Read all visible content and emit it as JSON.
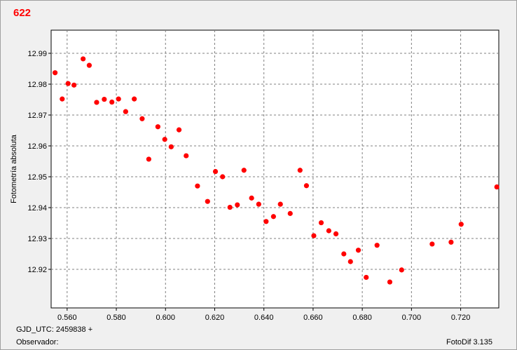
{
  "chart_data": {
    "type": "scatter",
    "title": "622",
    "xlabel": "",
    "ylabel": "Fotometría absoluta",
    "xlim": [
      0.5535,
      0.7355
    ],
    "ylim": [
      12.9975,
      12.9075
    ],
    "y_inverted": true,
    "grid": true,
    "marker_color": "#ff0000",
    "x_ticks": [
      "0.560",
      "0.580",
      "0.600",
      "0.620",
      "0.640",
      "0.660",
      "0.680",
      "0.700",
      "0.720"
    ],
    "x_tick_values": [
      0.56,
      0.58,
      0.6,
      0.62,
      0.64,
      0.66,
      0.68,
      0.7,
      0.72
    ],
    "y_ticks": [
      "12.92",
      "12.93",
      "12.94",
      "12.95",
      "12.96",
      "12.97",
      "12.98",
      "12.99"
    ],
    "y_tick_values": [
      12.92,
      12.93,
      12.94,
      12.95,
      12.96,
      12.97,
      12.98,
      12.99
    ],
    "points": [
      [
        0.5551,
        12.9837
      ],
      [
        0.558,
        12.9752
      ],
      [
        0.5604,
        12.9802
      ],
      [
        0.5628,
        12.9797
      ],
      [
        0.5665,
        12.9882
      ],
      [
        0.569,
        12.9861
      ],
      [
        0.572,
        12.9741
      ],
      [
        0.5751,
        12.9751
      ],
      [
        0.5782,
        12.9742
      ],
      [
        0.5809,
        12.9752
      ],
      [
        0.5838,
        12.9711
      ],
      [
        0.5873,
        12.9752
      ],
      [
        0.5905,
        12.9688
      ],
      [
        0.5932,
        12.9557
      ],
      [
        0.5969,
        12.9662
      ],
      [
        0.5997,
        12.9621
      ],
      [
        0.6023,
        12.9597
      ],
      [
        0.6055,
        12.9652
      ],
      [
        0.6084,
        12.9568
      ],
      [
        0.613,
        12.947
      ],
      [
        0.6171,
        12.942
      ],
      [
        0.6203,
        12.9517
      ],
      [
        0.6232,
        12.95
      ],
      [
        0.6262,
        12.9401
      ],
      [
        0.6292,
        12.9409
      ],
      [
        0.6319,
        12.9521
      ],
      [
        0.635,
        12.9431
      ],
      [
        0.6379,
        12.9411
      ],
      [
        0.6409,
        12.9355
      ],
      [
        0.6439,
        12.9371
      ],
      [
        0.6467,
        12.9411
      ],
      [
        0.6507,
        12.9381
      ],
      [
        0.6547,
        12.9521
      ],
      [
        0.6573,
        12.9471
      ],
      [
        0.6603,
        12.9309
      ],
      [
        0.6633,
        12.9351
      ],
      [
        0.6664,
        12.9325
      ],
      [
        0.6693,
        12.9315
      ],
      [
        0.6725,
        12.925
      ],
      [
        0.6752,
        12.9225
      ],
      [
        0.6784,
        12.9262
      ],
      [
        0.6816,
        12.9174
      ],
      [
        0.686,
        12.9278
      ],
      [
        0.6912,
        12.9159
      ],
      [
        0.696,
        12.9198
      ],
      [
        0.7084,
        12.9282
      ],
      [
        0.7161,
        12.9288
      ],
      [
        0.7202,
        12.9346
      ],
      [
        0.7347,
        12.9467
      ]
    ]
  },
  "footer": {
    "gjd_label": "GJD_UTC: 2459838 +",
    "observer_label": "Observador:",
    "software": "FotoDif 3.135"
  }
}
